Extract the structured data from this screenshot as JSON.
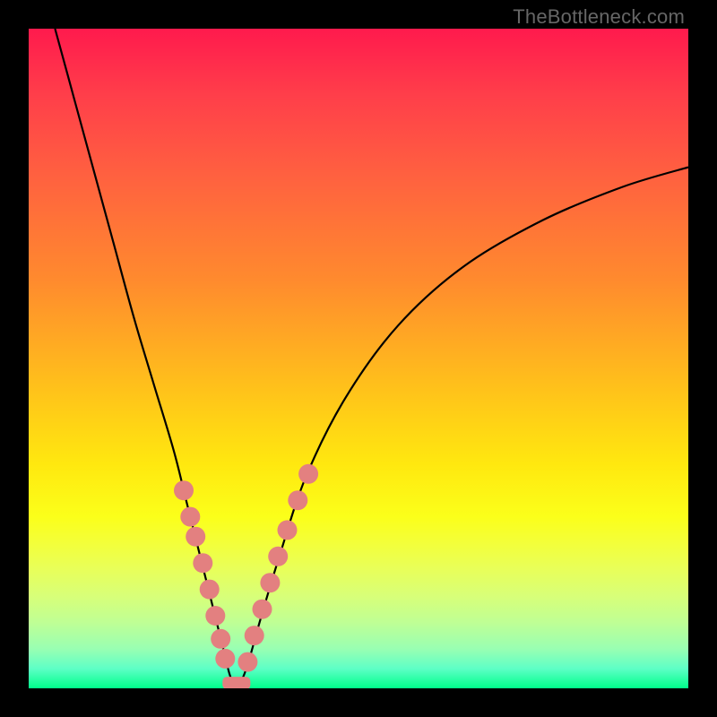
{
  "watermark": "TheBottleneck.com",
  "colors": {
    "frame": "#000000",
    "curve": "#000000",
    "marker": "#e38080",
    "gradient_top": "#ff1a4d",
    "gradient_bottom": "#00ff8a"
  },
  "chart_data": {
    "type": "line",
    "title": "",
    "xlabel": "",
    "ylabel": "",
    "xlim": [
      0,
      100
    ],
    "ylim": [
      0,
      100
    ],
    "series": [
      {
        "name": "bottleneck-curve",
        "x": [
          4,
          7,
          10,
          13,
          16,
          19,
          22,
          24,
          26,
          28,
          29.5,
          30.5,
          31.5,
          33,
          35,
          38,
          42,
          48,
          56,
          66,
          78,
          90,
          100
        ],
        "y": [
          100,
          89,
          78,
          67,
          56,
          46,
          36,
          28,
          20,
          12,
          6,
          2,
          0,
          3,
          10,
          20,
          32,
          44,
          55,
          64,
          71,
          76,
          79
        ]
      }
    ],
    "markers_left": [
      {
        "x": 23.5,
        "y": 30
      },
      {
        "x": 24.5,
        "y": 26
      },
      {
        "x": 25.3,
        "y": 23
      },
      {
        "x": 26.4,
        "y": 19
      },
      {
        "x": 27.4,
        "y": 15
      },
      {
        "x": 28.3,
        "y": 11
      },
      {
        "x": 29.1,
        "y": 7.5
      },
      {
        "x": 29.8,
        "y": 4.5
      }
    ],
    "markers_right": [
      {
        "x": 33.2,
        "y": 4
      },
      {
        "x": 34.2,
        "y": 8
      },
      {
        "x": 35.4,
        "y": 12
      },
      {
        "x": 36.6,
        "y": 16
      },
      {
        "x": 37.8,
        "y": 20
      },
      {
        "x": 39.2,
        "y": 24
      },
      {
        "x": 40.8,
        "y": 28.5
      },
      {
        "x": 42.4,
        "y": 32.5
      }
    ],
    "valley_segment": {
      "x0": 30.2,
      "x1": 32.8,
      "y": 0.8
    }
  }
}
